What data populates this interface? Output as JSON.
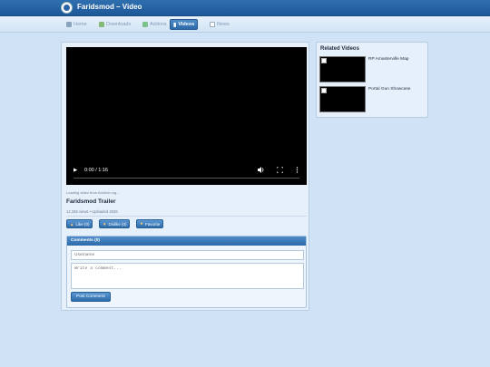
{
  "header": {
    "title": "Faridsmod – Video"
  },
  "nav": {
    "items": [
      {
        "label": "Home",
        "icon": "home-icon",
        "active": false
      },
      {
        "label": "Downloads",
        "icon": "downloads-icon",
        "active": false
      },
      {
        "label": "Addons",
        "icon": "addons-icon",
        "active": false
      },
      {
        "label": "Videos",
        "icon": "videos-icon",
        "active": true
      },
      {
        "label": "News",
        "icon": "news-icon",
        "active": false
      }
    ]
  },
  "video": {
    "time": "0:00 / 1:16",
    "progress": 0,
    "loading_text": "Loading video from Archive.org...",
    "title": "Faridsmod Trailer",
    "meta": "12,345 views • Uploaded 2026"
  },
  "actions": {
    "like_label": "Like (0)",
    "dislike_label": "Dislike (0)",
    "favorite_label": "Favorite"
  },
  "comments": {
    "header": "Comments (0)",
    "username_placeholder": "Username",
    "comment_placeholder": "Write a comment...",
    "post_label": "Post Comment"
  },
  "related": {
    "title": "Related Videos",
    "items": [
      {
        "title": "RP Amasterville Map"
      },
      {
        "title": "Portal Gun Showcase"
      }
    ]
  },
  "colors": {
    "header": "#1d5898",
    "accent": "#2c6aa9",
    "background": "#cfe2f6"
  }
}
